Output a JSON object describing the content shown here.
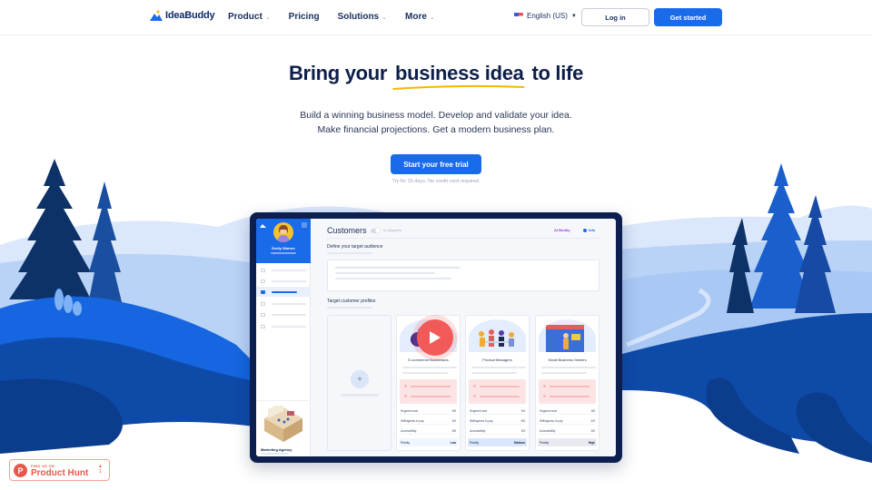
{
  "nav": {
    "brand": "IdeaBuddy",
    "links": [
      {
        "label": "Product",
        "dropdown": true
      },
      {
        "label": "Pricing",
        "dropdown": false
      },
      {
        "label": "Solutions",
        "dropdown": true
      },
      {
        "label": "More",
        "dropdown": true
      }
    ],
    "language": "English (US)",
    "login_label": "Log in",
    "get_started_label": "Get started"
  },
  "hero": {
    "title_pre": "Bring your",
    "title_highlight": "business idea",
    "title_post": "to life",
    "subtitle_line1": "Build a winning business model. Develop and validate your idea.",
    "subtitle_line2": "Make financial projections. Get a modern business plan.",
    "cta_label": "Start your free trial",
    "cta_note": "Try for 15 days. No credit card required."
  },
  "app_preview": {
    "user_name": "Emily Warren",
    "page_title": "Customers",
    "status_label": "In progress",
    "ai_label": "AI Buddy",
    "info_label": "Info",
    "section1_title": "Define your target audience",
    "section2_title": "Target customer profiles",
    "sidebar_footer_label": "Marketing Agency",
    "add_icon": "plus-icon",
    "cards": [
      {
        "title": "E-commerce Businesses",
        "rows": [
          {
            "label": "Segment size",
            "value": "5/5"
          },
          {
            "label": "Willingness to pay",
            "value": "4/5"
          },
          {
            "label": "Accessibility",
            "value": "5/5"
          }
        ],
        "priority_label": "Priority",
        "priority": "Low",
        "priority_bg": "#eef6ff"
      },
      {
        "title": "Product Managers",
        "rows": [
          {
            "label": "Segment size",
            "value": "3/5"
          },
          {
            "label": "Willingness to pay",
            "value": "5/5"
          },
          {
            "label": "Accessibility",
            "value": "2/5"
          }
        ],
        "priority_label": "Priority",
        "priority": "Medium",
        "priority_bg": "#d9e6fb"
      },
      {
        "title": "Small Business Owners",
        "rows": [
          {
            "label": "Segment size",
            "value": "3/5"
          },
          {
            "label": "Willingness to pay",
            "value": "4/5"
          },
          {
            "label": "Accessibility",
            "value": "3/5"
          }
        ],
        "priority_label": "Priority",
        "priority": "High",
        "priority_bg": "#e8eaef"
      }
    ]
  },
  "product_hunt": {
    "small": "FIND US ON",
    "big": "Product Hunt",
    "count": "1"
  },
  "colors": {
    "accent": "#1a6bea",
    "navy": "#0c1f4f",
    "highlight": "#f5b800",
    "product_hunt": "#e8584a"
  }
}
